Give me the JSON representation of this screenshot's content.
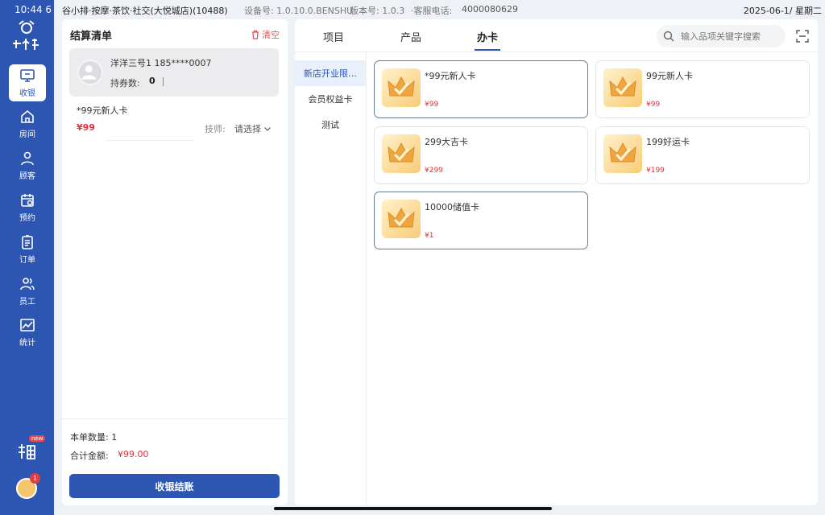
{
  "status_bar": {
    "time": "10:44 6",
    "store": "谷小排·按摩·茶饮·社交(大悦城店)(10488)",
    "device": "设备号: 1.0.10.0.BENSHU",
    "version": "版本号: 1.0.3",
    "hotline_label": "·客服电话:",
    "phone": "4000080629",
    "date": "2025-06-1/ 星期二"
  },
  "sidebar": {
    "logo_text": "谷小排",
    "items": [
      {
        "label": "收银",
        "icon": "monitor-icon",
        "active": true
      },
      {
        "label": "房间",
        "icon": "home-icon"
      },
      {
        "label": "顾客",
        "icon": "user-icon"
      },
      {
        "label": "预约",
        "icon": "calendar-icon"
      },
      {
        "label": "订单",
        "icon": "clipboard-icon"
      },
      {
        "label": "员工",
        "icon": "users-icon"
      },
      {
        "label": "统计",
        "icon": "chart-icon"
      }
    ],
    "new_badge": "new",
    "notification_count": "1"
  },
  "checkout": {
    "title": "结算清单",
    "clear": "清空",
    "member": {
      "name": "洋洋三号1 185****0007",
      "coupon_label": "持券数:",
      "coupon_count": "0"
    },
    "items": [
      {
        "name": "*99元新人卡",
        "price": "¥99",
        "tech_label": "技师:",
        "tech_value": "请选择"
      }
    ],
    "quantity": "本单数量: 1",
    "total_label": "合计金额:",
    "total": "¥99.00",
    "pay_button": "收银结账"
  },
  "tabs": [
    {
      "label": "项目"
    },
    {
      "label": "产品"
    },
    {
      "label": "办卡",
      "active": true
    }
  ],
  "search": {
    "placeholder": "输入品项关键字搜索"
  },
  "categories": [
    {
      "label": "新店开业限…",
      "active": true
    },
    {
      "label": "会员权益卡"
    },
    {
      "label": "测试"
    }
  ],
  "cards": [
    {
      "name": "*99元新人卡",
      "price": "¥99",
      "selected": true
    },
    {
      "name": "99元新人卡",
      "price": "¥99"
    },
    {
      "name": "299大吉卡",
      "price": "¥299"
    },
    {
      "name": "199好运卡",
      "price": "¥199"
    },
    {
      "name": "10000储值卡",
      "price": "¥1",
      "selected": true
    }
  ],
  "colors": {
    "primary": "#2d56b3",
    "price_red": "#e0323c",
    "background": "#eef1f5"
  }
}
